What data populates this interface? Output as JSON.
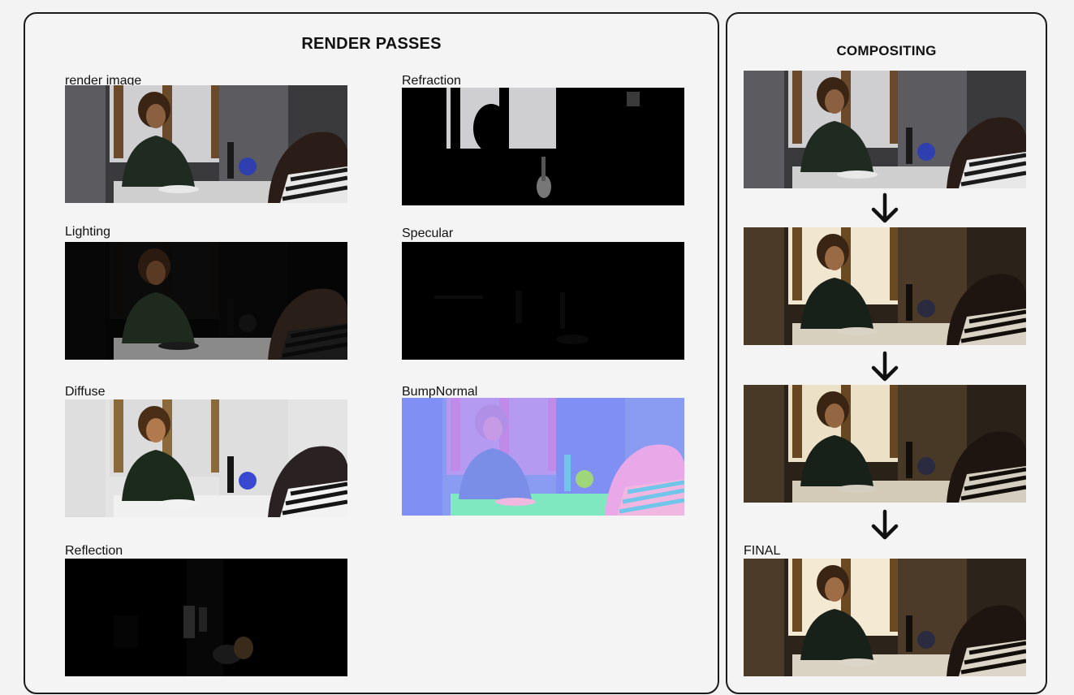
{
  "render_passes": {
    "title": "RENDER PASSES",
    "items": [
      {
        "label": "render image",
        "style": "beauty"
      },
      {
        "label": "Refraction",
        "style": "refraction"
      },
      {
        "label": "Lighting",
        "style": "lighting"
      },
      {
        "label": "Specular",
        "style": "specular"
      },
      {
        "label": "Diffuse",
        "style": "diffuse"
      },
      {
        "label": "BumpNormal",
        "style": "normal"
      },
      {
        "label": "Reflection",
        "style": "reflection"
      }
    ]
  },
  "compositing": {
    "title": "COMPOSITING",
    "steps": [
      {
        "label": "",
        "style": "beauty"
      },
      {
        "label": "",
        "style": "warm"
      },
      {
        "label": "",
        "style": "warm2"
      },
      {
        "label": "FINAL",
        "style": "final"
      }
    ]
  },
  "colors": {
    "panel_border": "#1a1a1a",
    "background": "#f3f3f3",
    "arrow": "#111111"
  }
}
